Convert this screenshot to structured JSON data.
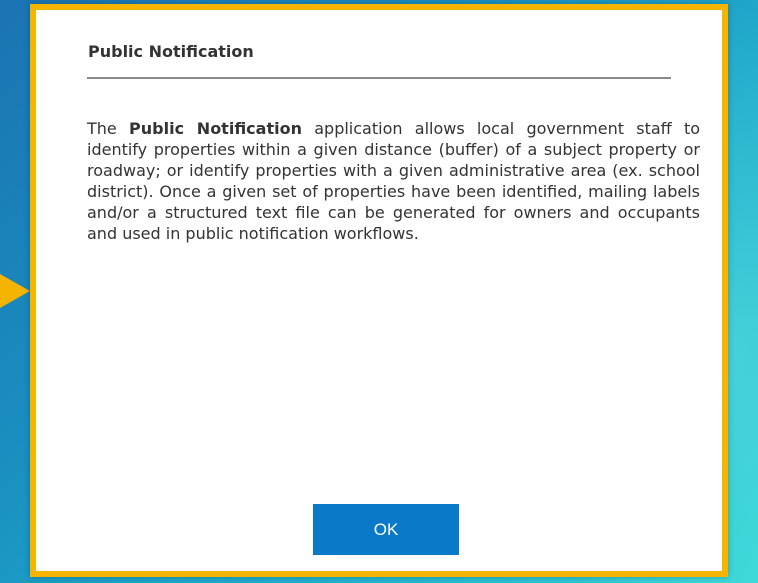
{
  "dialog": {
    "title": "Public Notification",
    "body": {
      "before": "The ",
      "bold": "Public Notification",
      "after": " application allows local government staff to identify properties within a given distance (buffer) of a subject property or roadway; or identify properties with a given administrative area (ex. school district). Once a given set of properties have been identified, mailing labels and/or a structured text file can be generated for owners and occupants and used in public notification workflows."
    },
    "ok_label": "OK"
  },
  "colors": {
    "accent_border": "#f5b400",
    "button": "#0a79c8",
    "background_start": "#1b73b3",
    "background_end": "#37d6d6"
  }
}
